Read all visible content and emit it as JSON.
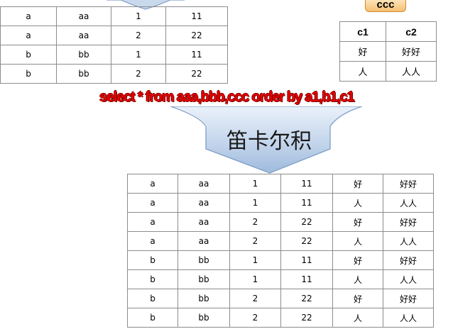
{
  "left_table": {
    "rows": [
      [
        "a",
        "aa",
        "1",
        "11"
      ],
      [
        "a",
        "aa",
        "2",
        "22"
      ],
      [
        "b",
        "bb",
        "1",
        "11"
      ],
      [
        "b",
        "bb",
        "2",
        "22"
      ]
    ]
  },
  "ccc": {
    "label": "ccc",
    "headers": [
      "c1",
      "c2"
    ],
    "rows": [
      [
        "好",
        "好好"
      ],
      [
        "人",
        "人人"
      ]
    ]
  },
  "sql": "select * from aaa,bbb,ccc order by a1,b1,c1",
  "cartesian_label": "笛卡尔积",
  "result_table": {
    "rows": [
      [
        "a",
        "aa",
        "1",
        "11",
        "好",
        "好好"
      ],
      [
        "a",
        "aa",
        "1",
        "11",
        "人",
        "人人"
      ],
      [
        "a",
        "aa",
        "2",
        "22",
        "好",
        "好好"
      ],
      [
        "a",
        "aa",
        "2",
        "22",
        "人",
        "人人"
      ],
      [
        "b",
        "bb",
        "1",
        "11",
        "好",
        "好好"
      ],
      [
        "b",
        "bb",
        "1",
        "11",
        "人",
        "人人"
      ],
      [
        "b",
        "bb",
        "2",
        "22",
        "好",
        "好好"
      ],
      [
        "b",
        "bb",
        "2",
        "22",
        "人",
        "人人"
      ]
    ]
  },
  "colors": {
    "arrow_fill": "#b8cde6",
    "arrow_stroke": "#7f9fc7",
    "sql_text": "#e60000",
    "ccc_label_bg": "#f5bf73"
  }
}
